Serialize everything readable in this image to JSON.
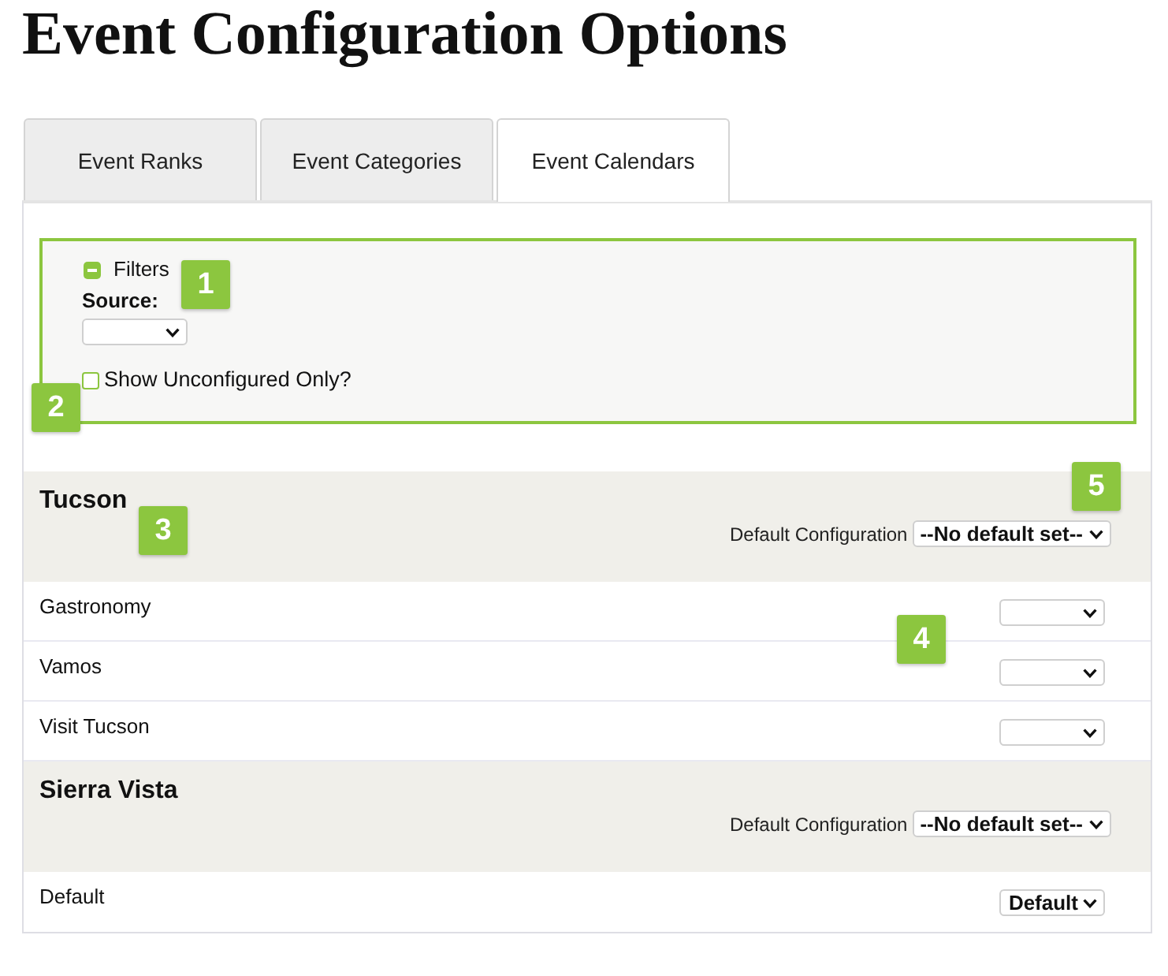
{
  "page": {
    "title": "Event Configuration Options"
  },
  "tabs": [
    {
      "label": "Event Ranks",
      "selected": false
    },
    {
      "label": "Event Categories",
      "selected": false
    },
    {
      "label": "Event Calendars",
      "selected": true
    }
  ],
  "filters": {
    "label": "Filters",
    "expanded": true,
    "source": {
      "label": "Source:"
    },
    "show_unconfigured": {
      "label": "Show Unconfigured Only?",
      "checked": false
    }
  },
  "sections": [
    {
      "name": "Tucson",
      "default_configuration": {
        "label": "Default Configuration",
        "value": "--No default set--"
      },
      "calendars": [
        {
          "name": "Gastronomy"
        },
        {
          "name": "Vamos"
        },
        {
          "name": "Visit Tucson"
        }
      ]
    },
    {
      "name": "Sierra Vista",
      "default_configuration": {
        "label": "Default Configuration",
        "value": "--No default set--"
      },
      "calendars": [
        {
          "name": "Default",
          "value": "Default"
        }
      ]
    }
  ],
  "callouts": [
    {
      "label": "1"
    },
    {
      "label": "2"
    },
    {
      "label": "3"
    },
    {
      "label": "4"
    },
    {
      "label": "5"
    }
  ]
}
